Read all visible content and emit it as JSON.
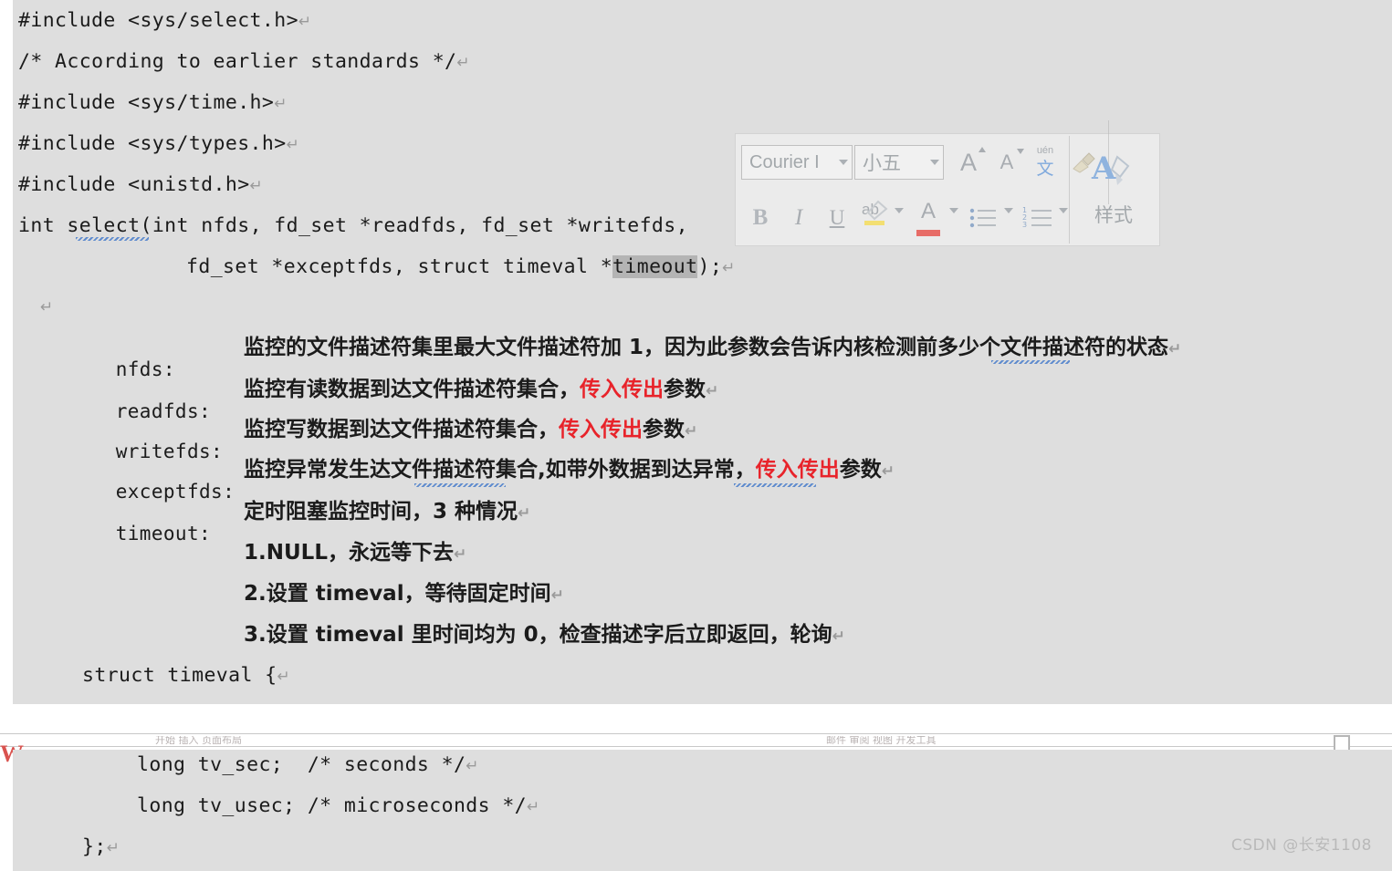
{
  "document": {
    "top_section": {
      "code_lines": [
        "#include <sys/select.h>",
        "/* According to earlier standards */",
        "#include <sys/time.h>",
        "#include <sys/types.h>",
        "#include <unistd.h>"
      ],
      "signature": {
        "line1_before": "int ",
        "line1_func": "select",
        "line1_after": "(int nfds, fd_set *readfds, fd_set *writefds,",
        "line2_before": "fd_set *exceptfds, struct timeval *",
        "line2_selected": "timeout",
        "line2_after": ");"
      },
      "params": [
        {
          "name": "nfds:",
          "desc_1": "监控的文件描述符集里最大文件描述符加 1，因为此参数会告诉内核检测前多少个文件描述符的状态",
          "desc_red": "",
          "desc_2": ""
        },
        {
          "name": "readfds:",
          "desc_1": "监控有读数据到达文件描述符集合，",
          "desc_red": "传入传出",
          "desc_2": "参数"
        },
        {
          "name": "writefds:",
          "desc_1": "监控写数据到达文件描述符集合，",
          "desc_red": "传入传出",
          "desc_2": "参数"
        },
        {
          "name": "exceptfds:",
          "desc_1": "监控异常发生达文件描述符集合,如带外数据到达异常，",
          "desc_red": "传入传出",
          "desc_2": "参数"
        },
        {
          "name": "timeout:",
          "desc_1": "定时阻塞监控时间，3 种情况",
          "desc_red": "",
          "desc_2": ""
        }
      ],
      "timeout_cases": [
        "1.NULL，永远等下去",
        "2.设置 timeval，等待固定时间",
        "3.设置 timeval 里时间均为 0，检查描述字后立即返回，轮询"
      ],
      "struct_open": "struct timeval {"
    },
    "bottom_section": {
      "code_lines": [
        "long tv_sec;  /* seconds */",
        "long tv_usec; /* microseconds */",
        "};"
      ]
    }
  },
  "mini_toolbar": {
    "font_name": "Courier I",
    "font_size": "小五",
    "buttons": {
      "grow_font": "A",
      "shrink_font": "A",
      "phonetic_guide": "文",
      "clear_formatting": "",
      "bold": "B",
      "italic": "I",
      "underline": "U",
      "text_highlight": "ab",
      "font_color": "A",
      "bullets": "",
      "numbering": "",
      "styles_label": "样式"
    }
  },
  "clipped_strip": {
    "left_smudge": "开始  插入  页面布局",
    "right_smudge": "邮件  审阅  视图  开发工具",
    "word_mark": "W"
  },
  "watermark": "CSDN @长安1108",
  "colors": {
    "page_background": "#dedede",
    "text": "#1b1b1b",
    "accent_red": "#e8232a",
    "selection_gray": "#b4b4b4",
    "watermark_gray": "#b9b9b9",
    "word_red": "#d9534f"
  }
}
